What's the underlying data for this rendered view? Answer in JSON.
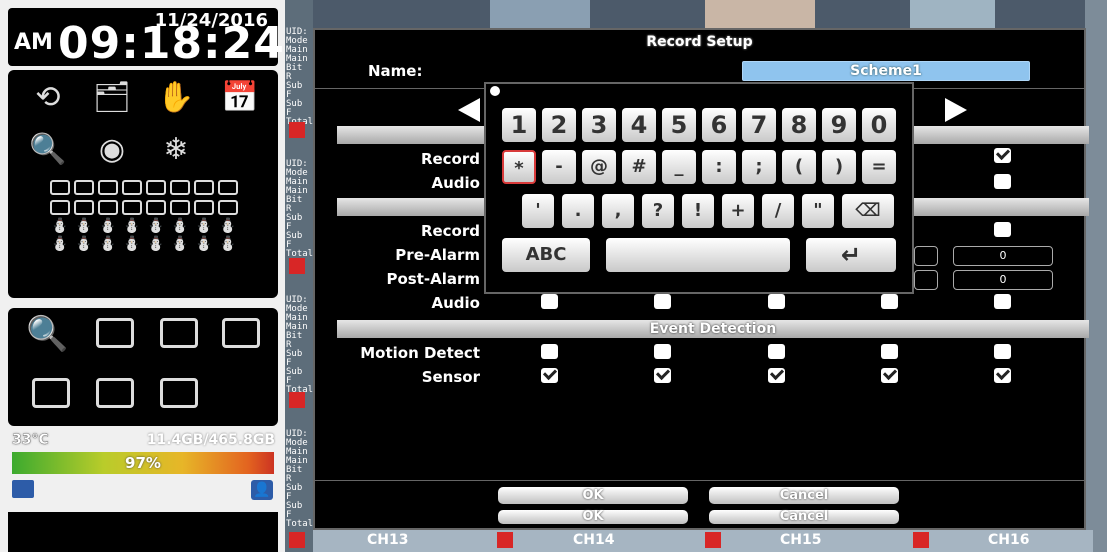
{
  "clock": {
    "date": "11/24/2016",
    "ampm": "AM",
    "time": "09:18:24"
  },
  "status": {
    "temperature": "33°C",
    "disk": "11.4GB/465.8GB",
    "usage_percent": "97%"
  },
  "dialog": {
    "title": "Record Setup",
    "name_label": "Name:",
    "name_value": "Scheme1",
    "record_label_1": "Record",
    "audio_label_1": "Audio",
    "record_label_2": "Record",
    "pre_alarm_label": "Pre-Alarm",
    "post_alarm_label": "Post-Alarm",
    "audio_label_2": "Audio",
    "event_detection_header": "Event Detection",
    "motion_detect_label": "Motion Detect",
    "sensor_label": "Sensor",
    "pre_alarm_value": "0",
    "post_alarm_value": "0",
    "ok_label": "OK",
    "cancel_label": "Cancel",
    "ok_label_echo": "OK",
    "cancel_label_echo": "Cancel"
  },
  "keyboard": {
    "row1": [
      "1",
      "2",
      "3",
      "4",
      "5",
      "6",
      "7",
      "8",
      "9",
      "0"
    ],
    "row2": [
      "*",
      "-",
      "@",
      "#",
      "_",
      ":",
      ";",
      "(",
      ")",
      "="
    ],
    "row3": [
      "'",
      ".",
      ",",
      "?",
      "!",
      "+",
      "/",
      "\""
    ],
    "abc_label": "ABC"
  },
  "channels": {
    "ch13": "CH13",
    "ch14": "CH14",
    "ch15": "CH15",
    "ch16": "CH16"
  },
  "checkboxes": {
    "record_first_col5": true,
    "audio_first_col5": false,
    "record_second_col5": false,
    "audio_row": [
      false,
      false,
      false,
      false,
      false
    ],
    "motion_row": [
      false,
      false,
      false,
      false,
      false
    ],
    "sensor_row": [
      true,
      true,
      true,
      true,
      true
    ]
  },
  "colors": {
    "accent": "#8fc4ee",
    "record_icon": "#d82626"
  }
}
